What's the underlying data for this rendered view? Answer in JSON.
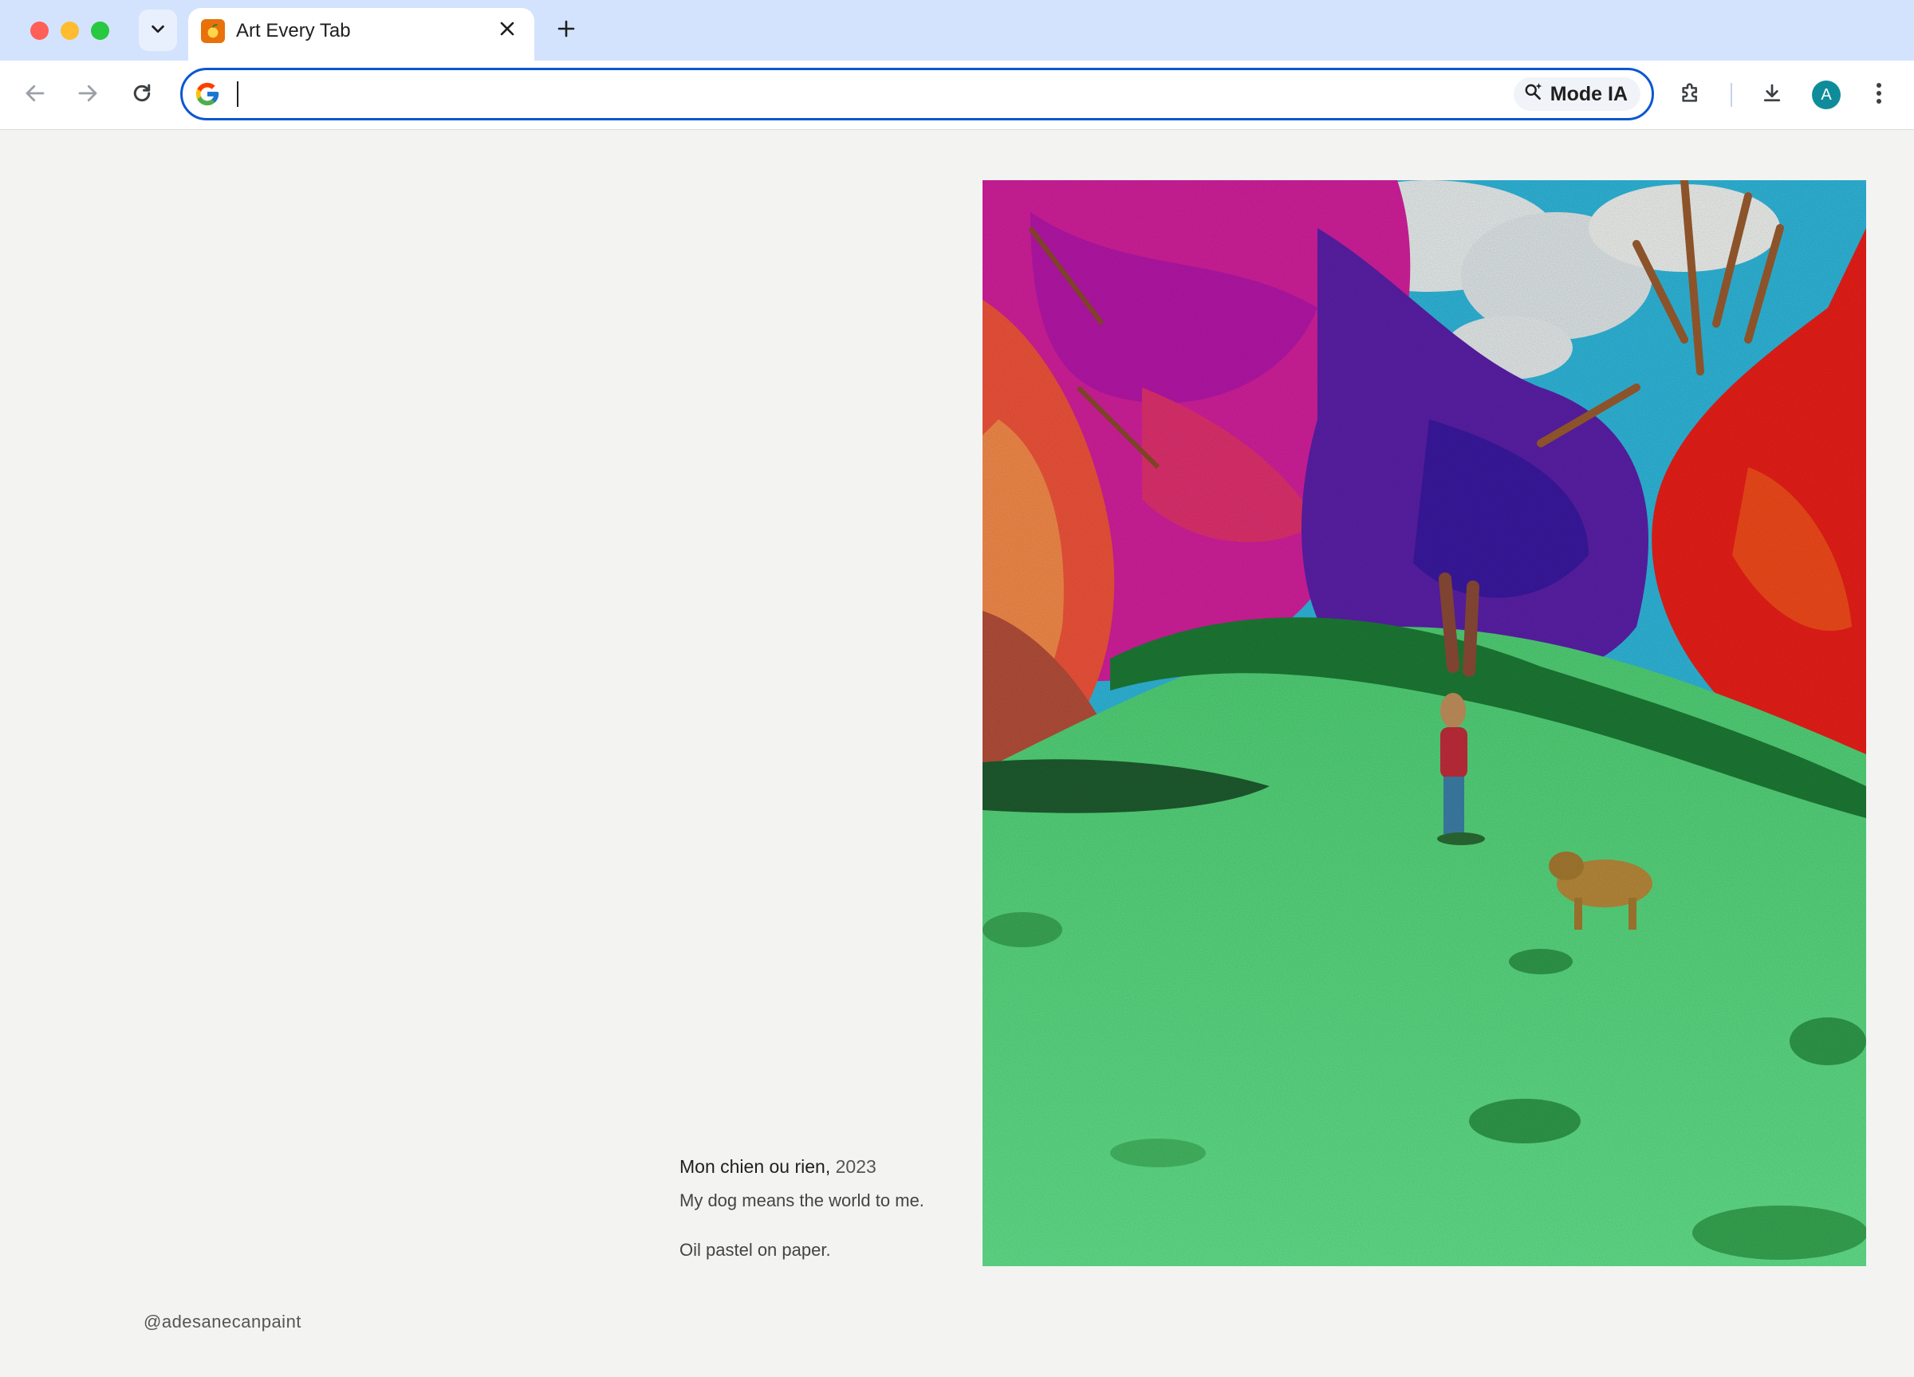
{
  "browser": {
    "tab": {
      "title": "Art Every Tab",
      "favicon": "orange-blob-favicon"
    },
    "omnibox": {
      "value": "",
      "mode_button_label": "Mode IA"
    },
    "profile": {
      "initial": "A",
      "color": "#0f8c9a"
    },
    "accent_color": "#0b57d0"
  },
  "artwork": {
    "title": "Mon chien ou rien,",
    "year": "2023",
    "description": "My dog means the world to me.",
    "medium": "Oil pastel on paper.",
    "artist_handle": "@adesanecanpaint"
  }
}
